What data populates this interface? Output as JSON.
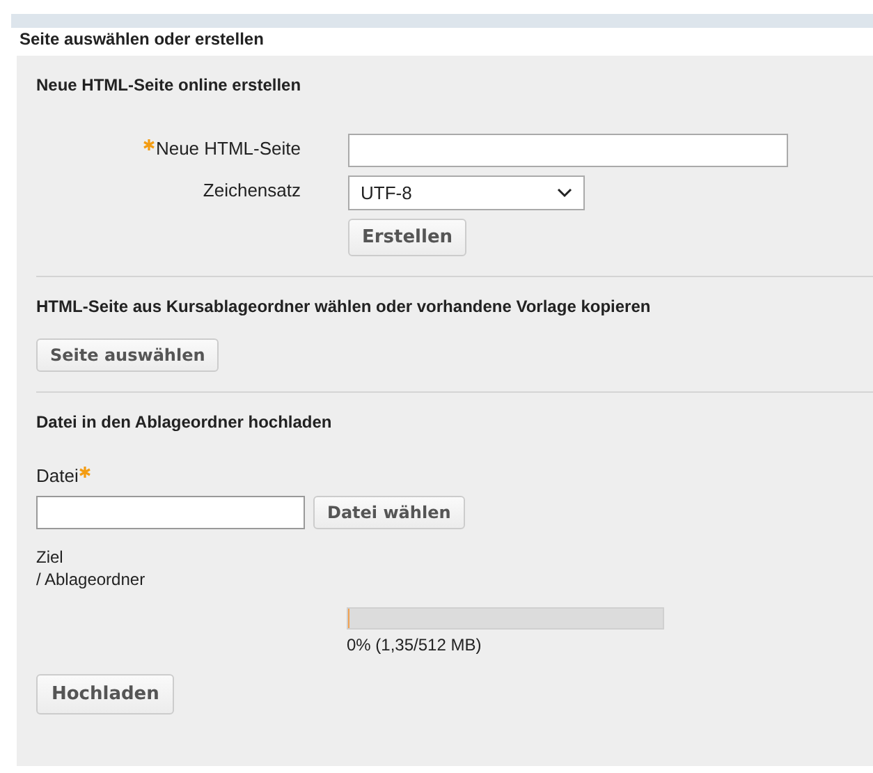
{
  "dialog": {
    "title": "Seite auswählen oder erstellen"
  },
  "create_section": {
    "heading": "Neue HTML-Seite online erstellen",
    "name_field": {
      "label": "Neue HTML-Seite",
      "required": true
    },
    "charset_field": {
      "label": "Zeichensatz",
      "value": "UTF-8"
    },
    "button": "Erstellen"
  },
  "select_section": {
    "heading": "HTML-Seite aus Kursablageordner wählen oder vorhandene Vorlage kopieren",
    "button": "Seite auswählen"
  },
  "upload_section": {
    "heading": "Datei in den Ablageordner hochladen",
    "file_field": {
      "label": "Datei",
      "required": true,
      "button": "Datei wählen"
    },
    "target_label": "Ziel",
    "target_path": "/ Ablageordner",
    "quota": {
      "level": 0.003,
      "reading": "0% (1,35/512 MB)"
    },
    "button": "Hochladen"
  }
}
